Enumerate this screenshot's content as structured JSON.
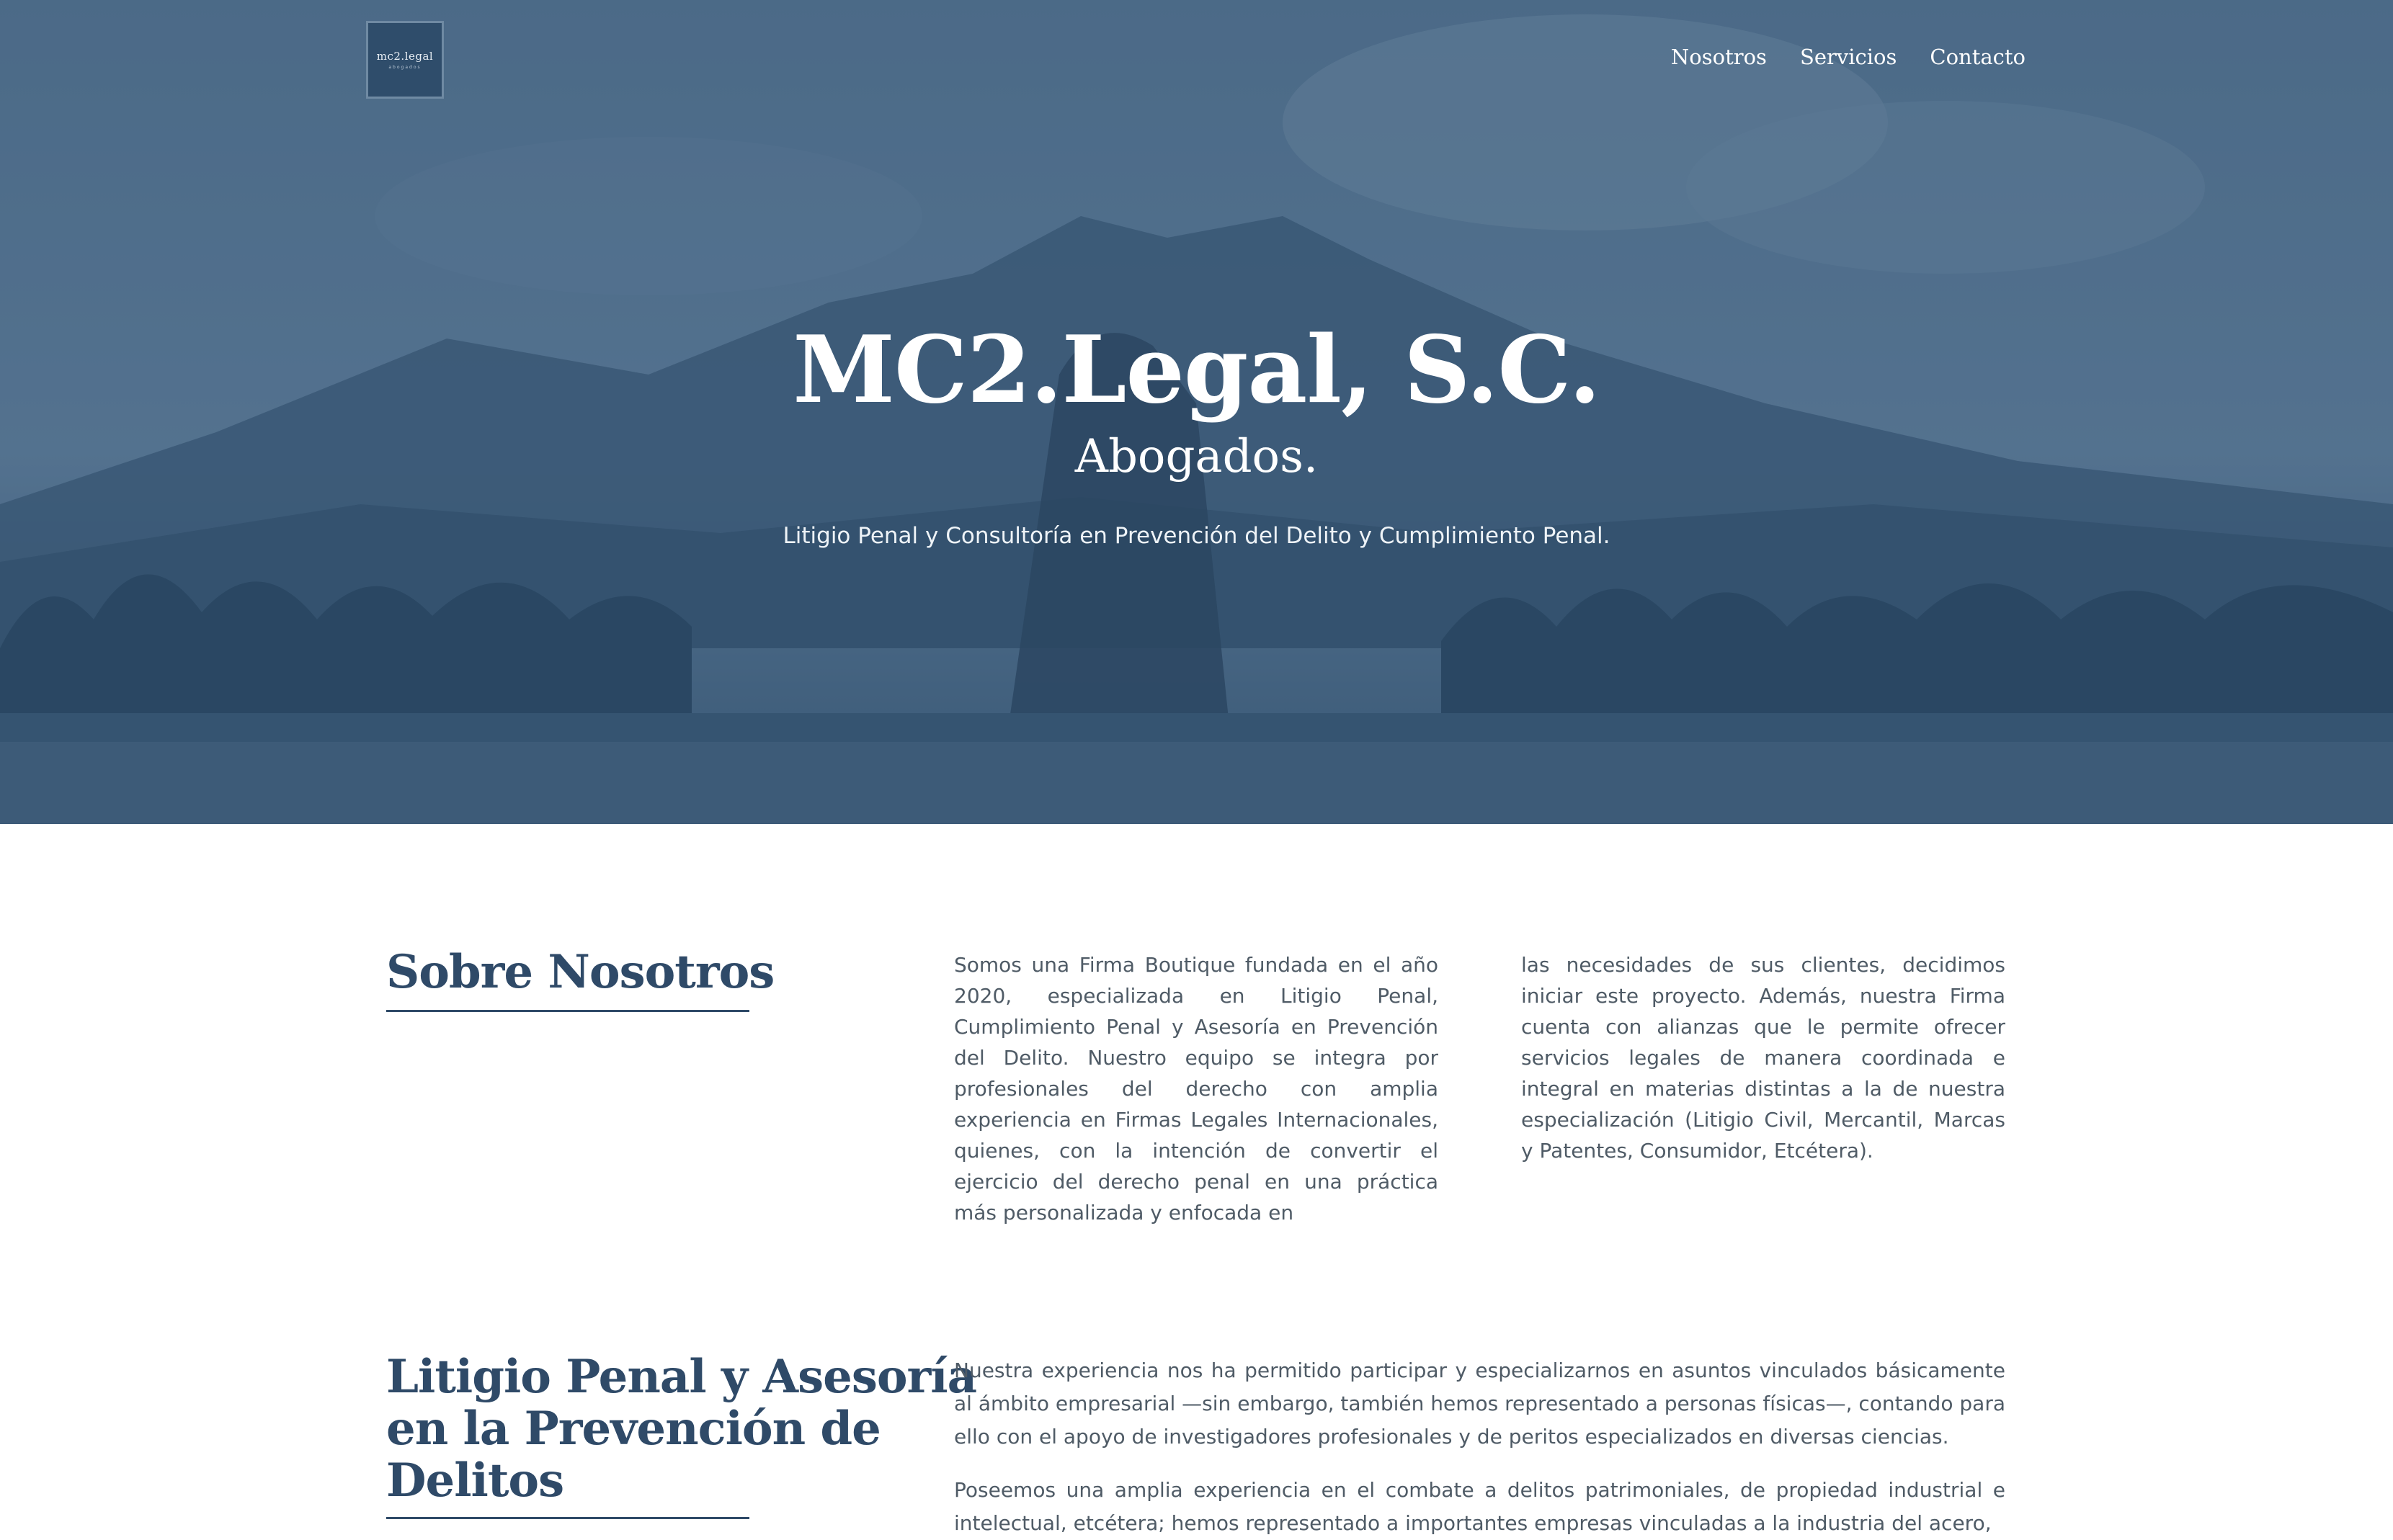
{
  "header": {
    "logo_text": "mc2.legal",
    "logo_sub": "abogados",
    "nav": [
      "Nosotros",
      "Servicios",
      "Contacto"
    ]
  },
  "hero": {
    "title": "MC2.Legal, S.C.",
    "subtitle": "Abogados.",
    "tagline": "Litigio Penal y Consultoría en Prevención del Delito y Cumplimiento Penal."
  },
  "about": {
    "title": "Sobre Nosotros",
    "col1": "Somos una Firma Boutique fundada en el año 2020, especializada en Litigio Penal, Cumplimiento Penal y Asesoría en Prevención del Delito. Nuestro equipo se integra por profesionales del derecho con amplia experiencia en Firmas Legales Internacionales, quienes, con la intención de convertir el ejercicio del derecho penal en una práctica más personalizada y enfocada en",
    "col2": "las necesidades de sus clientes, decidimos iniciar este proyecto. Además, nuestra Firma cuenta con alianzas que le permite ofrecer servicios legales de manera coordinada e integral en materias distintas a la de nuestra especialización (Litigio Civil, Mercantil, Marcas y Patentes, Consumidor, Etcétera)."
  },
  "litigio": {
    "title_lines": [
      "Litigio Penal y Asesoría",
      "en la Prevención de",
      "Delitos"
    ],
    "para1": "Nuestra experiencia nos ha permitido participar y especializarnos en asuntos vinculados básicamente al ámbito empresarial —sin embargo, también hemos representado a personas físicas—, contando para ello con el apoyo de investigadores profesionales y de peritos especializados en diversas ciencias.",
    "para2": "Poseemos una amplia experiencia en el combate a delitos patrimoniales, de propiedad industrial e intelectual, etcétera; hemos representado a importantes empresas vinculadas a la industria del acero,"
  },
  "colors": {
    "hero_overlay": "#4c6a86",
    "heading": "#2f4a68",
    "body_text": "#4f5b66"
  }
}
